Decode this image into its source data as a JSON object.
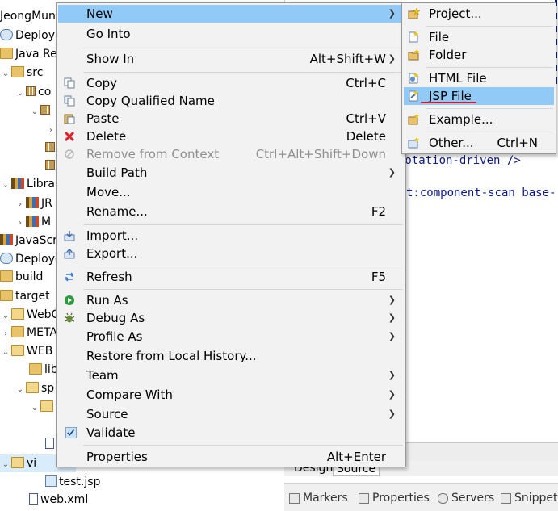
{
  "tree": {
    "rows": [
      {
        "label": "JeongMun",
        "indent": 0,
        "twisty": "",
        "icon": "project"
      },
      {
        "label": "Deploym",
        "indent": 1,
        "twisty": "",
        "icon": "deploy"
      },
      {
        "label": "Java Re",
        "indent": 0,
        "twisty": "",
        "icon": "folder"
      },
      {
        "label": "src",
        "indent": 0,
        "twisty": "⌄",
        "icon": "srcfolder"
      },
      {
        "label": "co",
        "indent": 1,
        "twisty": "⌄",
        "icon": "package"
      },
      {
        "label": "",
        "indent": 2,
        "twisty": "⌄",
        "icon": "package"
      },
      {
        "label": "",
        "indent": 3,
        "twisty": "›",
        "icon": ""
      },
      {
        "label": "",
        "indent": 3,
        "twisty": "",
        "icon": "package"
      },
      {
        "label": "",
        "indent": 3,
        "twisty": "",
        "icon": "package"
      },
      {
        "label": "Libra",
        "indent": 0,
        "twisty": "⌄",
        "icon": "library"
      },
      {
        "label": "JR",
        "indent": 1,
        "twisty": "›",
        "icon": "library"
      },
      {
        "label": "M",
        "indent": 1,
        "twisty": "›",
        "icon": "library"
      },
      {
        "label": "JavaScri",
        "indent": 0,
        "twisty": "",
        "icon": "library"
      },
      {
        "label": "Deploye",
        "indent": 0,
        "twisty": "",
        "icon": "deploy"
      },
      {
        "label": "build",
        "indent": 0,
        "twisty": "",
        "icon": "folder"
      },
      {
        "label": "target",
        "indent": 0,
        "twisty": "",
        "icon": "folder"
      },
      {
        "label": "WebCo",
        "indent": 0,
        "twisty": "⌄",
        "icon": "folder"
      },
      {
        "label": "META",
        "indent": 1,
        "twisty": "›",
        "icon": "folder"
      },
      {
        "label": "WEB",
        "indent": 1,
        "twisty": "⌄",
        "icon": "folder"
      },
      {
        "label": "lib",
        "indent": 2,
        "twisty": "",
        "icon": "folder"
      },
      {
        "label": "sp",
        "indent": 2,
        "twisty": "⌄",
        "icon": "folder"
      },
      {
        "label": "",
        "indent": 3,
        "twisty": "⌄",
        "icon": "folder"
      },
      {
        "label": "",
        "indent": 4,
        "twisty": "",
        "icon": ""
      },
      {
        "label": "",
        "indent": 3,
        "twisty": "",
        "icon": "xml"
      },
      {
        "label": "vi",
        "indent": 1,
        "twisty": "⌄",
        "icon": "folder"
      },
      {
        "label": "test.jsp",
        "indent": 2,
        "twisty": "",
        "icon": "jsp"
      },
      {
        "label": "web.xml",
        "indent": 1,
        "twisty": "",
        "icon": "xml"
      }
    ]
  },
  "editor": {
    "line1": "notation-driven />",
    "line2": "t:component-scan base-"
  },
  "design_tabs": {
    "design": "Design",
    "source": "Source"
  },
  "bottom_tabs": {
    "markers": "Markers",
    "properties": "Properties",
    "servers": "Servers",
    "snippets": "Snippets"
  },
  "context_menu": {
    "items": [
      {
        "label": "New",
        "accel": "",
        "submenu": true,
        "highlighted": true,
        "icon": ""
      },
      {
        "label": "Go Into",
        "accel": "",
        "submenu": false,
        "icon": ""
      },
      {
        "label": "Show In",
        "accel": "Alt+Shift+W",
        "submenu": true,
        "icon": ""
      },
      {
        "label": "Copy",
        "accel": "Ctrl+C",
        "submenu": false,
        "icon": "copy-icon"
      },
      {
        "label": "Copy Qualified Name",
        "accel": "",
        "submenu": false,
        "icon": "copy-qualified-icon"
      },
      {
        "label": "Paste",
        "accel": "Ctrl+V",
        "submenu": false,
        "icon": "paste-icon"
      },
      {
        "label": "Delete",
        "accel": "Delete",
        "submenu": false,
        "icon": "delete-icon"
      },
      {
        "label": "Remove from Context",
        "accel": "Ctrl+Alt+Shift+Down",
        "submenu": false,
        "disabled": true,
        "icon": "remove-context-icon"
      },
      {
        "label": "Build Path",
        "accel": "",
        "submenu": true,
        "icon": ""
      },
      {
        "label": "Move...",
        "accel": "",
        "submenu": false,
        "icon": ""
      },
      {
        "label": "Rename...",
        "accel": "F2",
        "submenu": false,
        "icon": ""
      },
      {
        "label": "Import...",
        "accel": "",
        "submenu": false,
        "icon": "import-icon"
      },
      {
        "label": "Export...",
        "accel": "",
        "submenu": false,
        "icon": "export-icon"
      },
      {
        "label": "Refresh",
        "accel": "F5",
        "submenu": false,
        "icon": "refresh-icon"
      },
      {
        "label": "Run As",
        "accel": "",
        "submenu": true,
        "icon": "run-icon"
      },
      {
        "label": "Debug As",
        "accel": "",
        "submenu": true,
        "icon": "debug-icon"
      },
      {
        "label": "Profile As",
        "accel": "",
        "submenu": true,
        "icon": ""
      },
      {
        "label": "Restore from Local History...",
        "accel": "",
        "submenu": false,
        "icon": ""
      },
      {
        "label": "Team",
        "accel": "",
        "submenu": true,
        "icon": ""
      },
      {
        "label": "Compare With",
        "accel": "",
        "submenu": true,
        "icon": ""
      },
      {
        "label": "Source",
        "accel": "",
        "submenu": true,
        "icon": ""
      },
      {
        "label": "Validate",
        "accel": "",
        "submenu": false,
        "icon": "checkbox-icon"
      },
      {
        "label": "Properties",
        "accel": "Alt+Enter",
        "submenu": false,
        "icon": ""
      }
    ]
  },
  "new_submenu": {
    "items": [
      {
        "label": "Project...",
        "accel": "",
        "icon": "new-project-icon"
      },
      {
        "label": "File",
        "accel": "",
        "icon": "new-file-icon"
      },
      {
        "label": "Folder",
        "accel": "",
        "icon": "new-folder-icon"
      },
      {
        "label": "HTML File",
        "accel": "",
        "icon": "html-file-icon"
      },
      {
        "label": "JSP File",
        "accel": "",
        "icon": "jsp-file-icon",
        "highlighted": true
      },
      {
        "label": "Example...",
        "accel": "",
        "icon": "example-icon"
      },
      {
        "label": "Other...",
        "accel": "Ctrl+N",
        "icon": "other-wizard-icon"
      }
    ]
  },
  "colors": {
    "highlight": "#91c9f7",
    "menu_bg": "#f2f2f2",
    "annotation_underline": "#e0141e"
  }
}
